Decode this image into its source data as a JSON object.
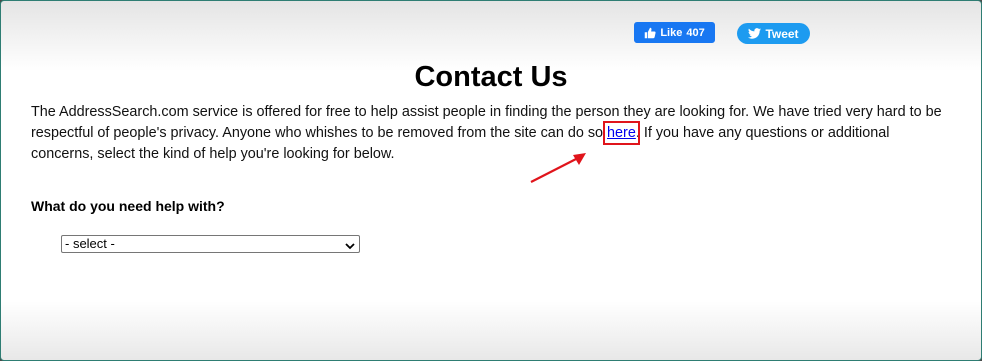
{
  "social": {
    "like_label": "Like",
    "like_count": "407",
    "tweet_label": "Tweet"
  },
  "page": {
    "title": "Contact Us",
    "intro_before_link": "The AddressSearch.com service is offered for free to help assist people in finding the person they are looking for. We have tried very hard to be respectful of people's privacy. Anyone who whishes to be removed from the site can do so ",
    "link_text": "here",
    "intro_after_link": ". If you have any questions or additional concerns, select the kind of help you're looking for below.",
    "help_label": "What do you need help with?",
    "select_value": "- select -"
  },
  "colors": {
    "facebook_blue": "#1877f2",
    "twitter_blue": "#1d9bf0",
    "highlight_red": "#e0141b",
    "link_blue": "#0000ee"
  },
  "icons": [
    "thumbs-up-icon",
    "twitter-bird-icon",
    "chevron-down-icon",
    "annotation-arrow-icon"
  ]
}
